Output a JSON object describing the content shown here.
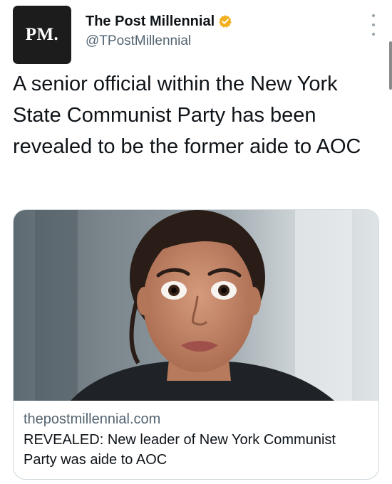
{
  "tweet": {
    "author": {
      "avatar_text": "PM.",
      "display_name": "The Post Millennial",
      "handle": "@TPostMillennial",
      "verified": true
    },
    "text": "A senior official within the New York State Communist Party has been revealed to be the former aide to AOC",
    "card": {
      "image_alt": "woman with wide eyes looking at camera",
      "domain": "thepostmillennial.com",
      "title": "REVEALED: New leader of New York Communist Party was aide to AOC"
    }
  },
  "icons": {
    "verified": "verified-badge-icon",
    "more": "more-options-icon"
  },
  "colors": {
    "verified_badge": "#f2b01e",
    "secondary_text": "#536471",
    "card_border": "#cfd9de",
    "avatar_bg": "#1c1c1c"
  }
}
